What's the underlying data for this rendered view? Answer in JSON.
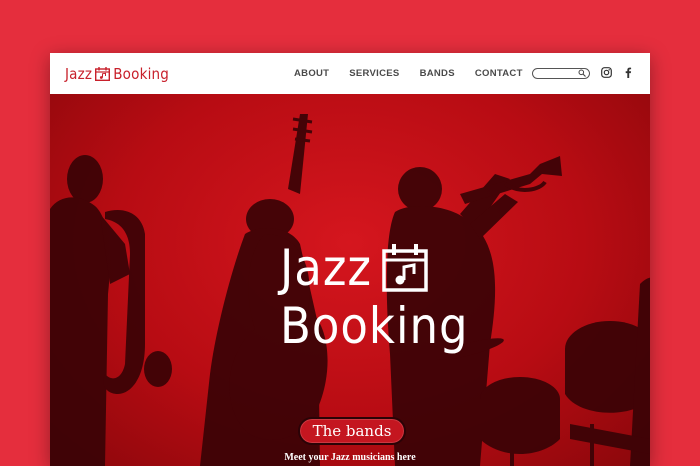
{
  "site": {
    "logo_text_1": "Jazz",
    "logo_text_2": "Booking"
  },
  "nav": {
    "items": [
      "ABOUT",
      "SERVICES",
      "BANDS",
      "CONTACT"
    ]
  },
  "search": {
    "placeholder": ""
  },
  "social": {
    "icons": [
      "instagram-icon",
      "facebook-icon"
    ]
  },
  "hero": {
    "title_line1": "Jazz",
    "title_line2": "Booking",
    "cta_label": "The bands",
    "tagline": "Meet your Jazz musicians here"
  },
  "colors": {
    "page_bg": "#e52e3d",
    "brand_red": "#c8202b",
    "hero_red": "#c4141c"
  }
}
